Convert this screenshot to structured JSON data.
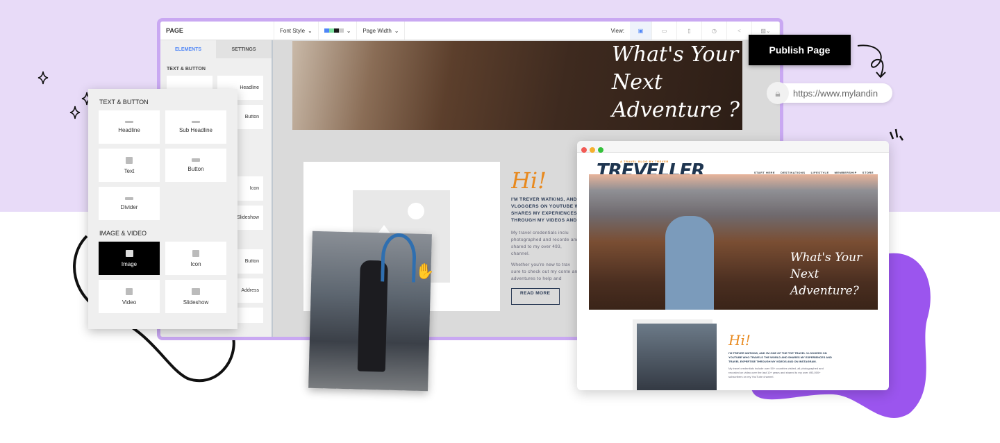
{
  "editor": {
    "toolbar": {
      "page_label": "PAGE",
      "font_style": "Font Style",
      "page_width": "Page Width",
      "view_label": "View:",
      "swatches": [
        "#4f86f7",
        "#7ee0a0",
        "#1a1a1a",
        "#cccccc"
      ],
      "icons": [
        "desktop-edit-icon",
        "desktop-icon",
        "mobile-icon",
        "history-icon",
        "share-icon",
        "settings-icon"
      ]
    },
    "sidebar": {
      "tabs": [
        {
          "label": "ELEMENTS",
          "active": true
        },
        {
          "label": "SETTINGS",
          "active": false
        }
      ],
      "section": "TEXT & BUTTON",
      "partial_items": [
        "Headline",
        "Button",
        "Icon",
        "Slideshow",
        "Button",
        "Address"
      ]
    },
    "hero_text": "What's Your Next Adventure ?",
    "content": {
      "greeting": "Hi!",
      "intro": "I'M TREVER WATKINS, AND VLOGGERS ON YOUTUBE W SHARES MY EXPERIENCES THROUGH MY VIDEOS AND",
      "para1": "My travel credentials inclu photographed and recorde and shared to my over 493, channel.",
      "para2": "Whether you're new to trav sure to check out my conte and adventures to help and",
      "read_more": "READ MORE"
    }
  },
  "panel": {
    "sections": [
      {
        "title": "TEXT & BUTTON",
        "items": [
          {
            "label": "Headline",
            "icon": "headline-icon"
          },
          {
            "label": "Sub Headline",
            "icon": "subheadline-icon"
          },
          {
            "label": "Text",
            "icon": "text-icon"
          },
          {
            "label": "Button",
            "icon": "button-icon"
          },
          {
            "label": "Divider",
            "icon": "divider-icon"
          }
        ]
      },
      {
        "title": "IMAGE & VIDEO",
        "items": [
          {
            "label": "Image",
            "icon": "image-icon",
            "selected": true
          },
          {
            "label": "Icon",
            "icon": "info-icon"
          },
          {
            "label": "Video",
            "icon": "video-icon"
          },
          {
            "label": "Slideshow",
            "icon": "slideshow-icon"
          }
        ]
      }
    ]
  },
  "publish": {
    "label": "Publish Page"
  },
  "url": {
    "text": "https://www.mylandin"
  },
  "preview": {
    "tagline": "A TRAVEL BLOG BY TREVER",
    "logo": "TREVELLER",
    "nav": [
      "START HERE",
      "DESTINATIONS",
      "LIFESTYLE",
      "MEMBERSHIP",
      "STORE"
    ],
    "hero_text": "What's Your Next Adventure?",
    "greeting": "Hi!",
    "intro": "I'M TREVER WATKINS, AND I'M ONE OF THE TOP TRAVEL VLOGGERS ON YOUTUBE WHO TRAVELS THE WORLD AND SHARES MY EXPERIENCES AND TRAVEL EXPERTISE THROUGH MY VIDEOS AND ON INSTAGRAM.",
    "para": "My travel credentials include over 50+ countries visited, all photographed and recorded on video over the last 10+ years and shared to my over 493,000+ subscribers on my YouTube channel."
  },
  "colors": {
    "lavender": "#e8dbf8",
    "purple_border": "#c9a8f2",
    "blob": "#9b55ee",
    "orange": "#e8891e",
    "navy": "#1e3550"
  }
}
